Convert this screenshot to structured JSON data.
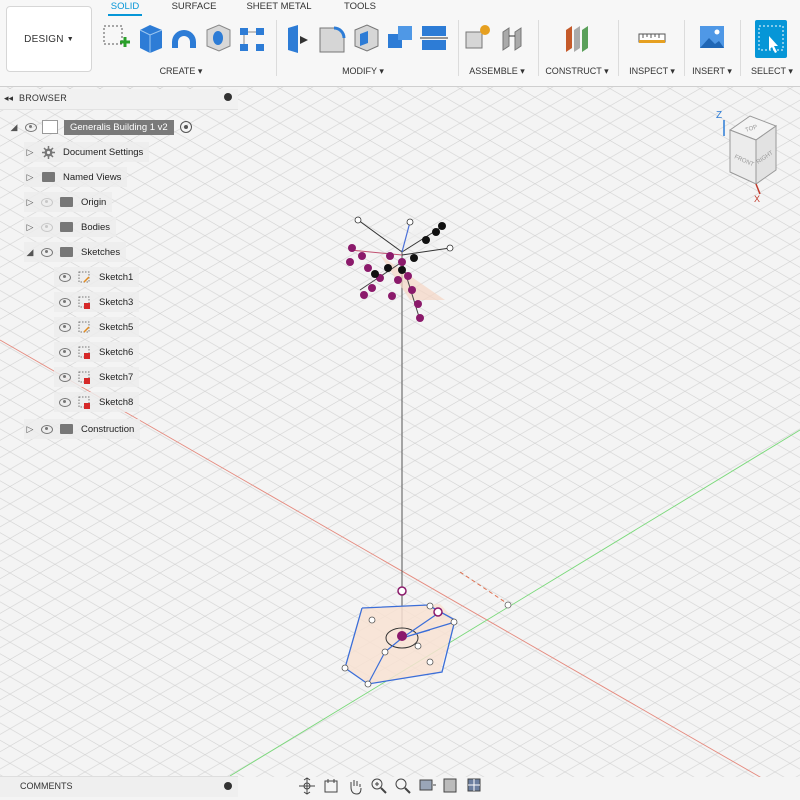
{
  "toolbar": {
    "design_label": "DESIGN",
    "tabs": [
      "SOLID",
      "SURFACE",
      "SHEET METAL",
      "TOOLS"
    ],
    "active_tab": "SOLID",
    "groups": {
      "create": "CREATE",
      "modify": "MODIFY",
      "assemble": "ASSEMBLE",
      "construct": "CONSTRUCT",
      "inspect": "INSPECT",
      "insert": "INSERT",
      "select": "SELECT"
    }
  },
  "browser": {
    "title": "BROWSER",
    "root": "Generalis Building 1 v2",
    "items": [
      {
        "label": "Document Settings"
      },
      {
        "label": "Named Views"
      },
      {
        "label": "Origin"
      },
      {
        "label": "Bodies"
      },
      {
        "label": "Sketches"
      }
    ],
    "sketches": [
      "Sketch1",
      "Sketch3",
      "Sketch5",
      "Sketch6",
      "Sketch7",
      "Sketch8"
    ],
    "construction": "Construction"
  },
  "viewcube": {
    "top": "TOP",
    "front": "FRONT",
    "right": "RIGHT",
    "axis_z": "Z",
    "axis_x": "X"
  },
  "comments": {
    "title": "COMMENTS"
  },
  "colors": {
    "accent": "#0696d7",
    "sketch_constraint": "#8b1a6b",
    "sketch_line_blue": "#3b6ed8",
    "axis_red": "#e05a4a",
    "axis_green": "#5ccc5c"
  }
}
